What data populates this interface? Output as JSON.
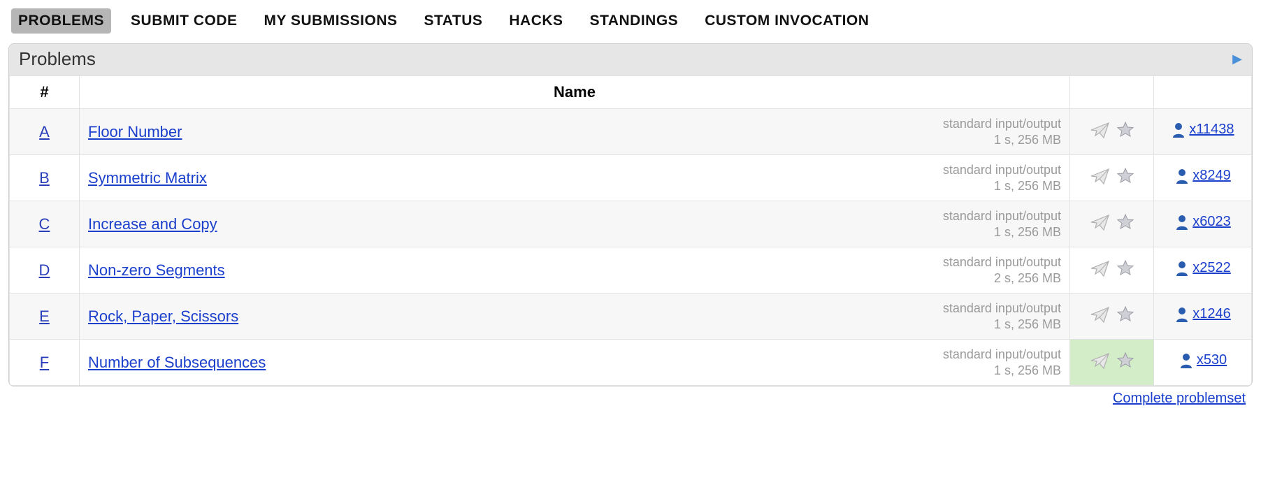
{
  "tabs": [
    {
      "label": "PROBLEMS",
      "active": true
    },
    {
      "label": "SUBMIT CODE",
      "active": false
    },
    {
      "label": "MY SUBMISSIONS",
      "active": false
    },
    {
      "label": "STATUS",
      "active": false
    },
    {
      "label": "HACKS",
      "active": false
    },
    {
      "label": "STANDINGS",
      "active": false
    },
    {
      "label": "CUSTOM INVOCATION",
      "active": false
    }
  ],
  "panel_title": "Problems",
  "columns": {
    "idx": "#",
    "name": "Name"
  },
  "footer_link": "Complete problemset",
  "problems": [
    {
      "idx": "A",
      "title": "Floor Number",
      "io": "standard input/output",
      "limits": "1 s, 256 MB",
      "solved": "x11438",
      "visited": false,
      "highlight": false
    },
    {
      "idx": "B",
      "title": "Symmetric Matrix",
      "io": "standard input/output",
      "limits": "1 s, 256 MB",
      "solved": "x8249",
      "visited": false,
      "highlight": false
    },
    {
      "idx": "C",
      "title": "Increase and Copy",
      "io": "standard input/output",
      "limits": "1 s, 256 MB",
      "solved": "x6023",
      "visited": false,
      "highlight": false
    },
    {
      "idx": "D",
      "title": "Non-zero Segments",
      "io": "standard input/output",
      "limits": "2 s, 256 MB",
      "solved": "x2522",
      "visited": false,
      "highlight": false
    },
    {
      "idx": "E",
      "title": "Rock, Paper, Scissors",
      "io": "standard input/output",
      "limits": "1 s, 256 MB",
      "solved": "x1246",
      "visited": true,
      "highlight": false
    },
    {
      "idx": "F",
      "title": "Number of Subsequences",
      "io": "standard input/output",
      "limits": "1 s, 256 MB",
      "solved": "x530",
      "visited": true,
      "highlight": true
    }
  ]
}
